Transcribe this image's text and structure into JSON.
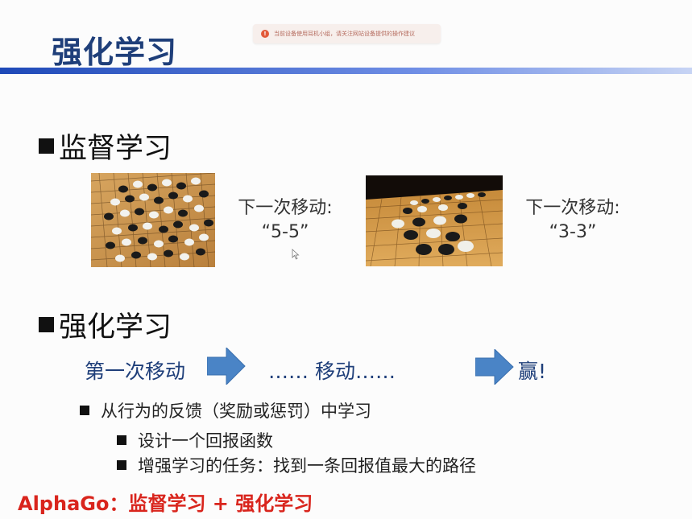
{
  "slide": {
    "title": "强化学习",
    "title_color": "#1f3f7a",
    "accent_bar_color": "#1e49b8"
  },
  "toast": {
    "message": "当前设备使用耳机小组，请关注网站设备提供的操作建议"
  },
  "supervised": {
    "heading": "监督学习",
    "example1": {
      "line1": "下一次移动:",
      "line2": "“5-5”"
    },
    "example2": {
      "line1": "下一次移动:",
      "line2": "“3-3”"
    }
  },
  "reinforcement": {
    "heading": "强化学习",
    "flow": {
      "step1": "第一次移动",
      "step2": "…… 移动……",
      "step3": "赢!"
    },
    "bullets": {
      "main": "从行为的反馈（奖励或惩罚）中学习",
      "sub1": "设计一个回报函数",
      "sub2": "增强学习的任务：找到一条回报值最大的路径"
    }
  },
  "footer": {
    "text": "AlphaGo：监督学习 + 强化学习",
    "color": "#d9251d"
  }
}
